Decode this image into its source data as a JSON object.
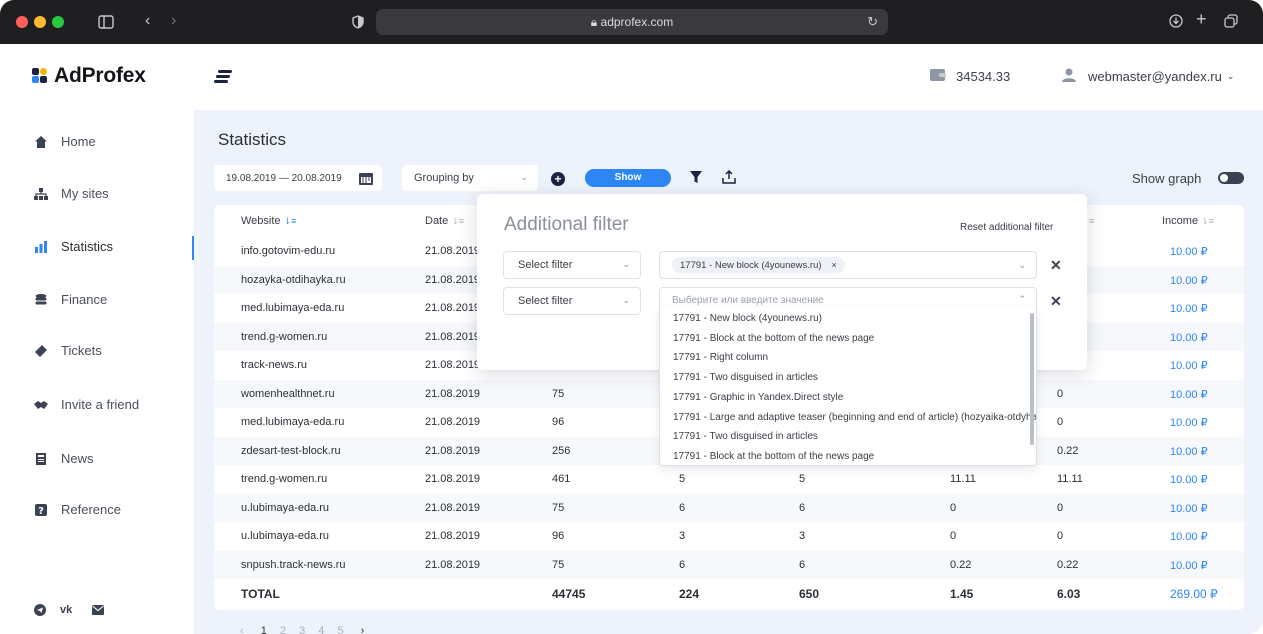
{
  "browser": {
    "url": "adprofex.com"
  },
  "brand": {
    "name": "AdProfex",
    "colors": {
      "accent": "#2e86f5",
      "dark": "#1c2240",
      "logo_yellow": "#f5b400",
      "logo_blue": "#2e86f5",
      "logo_dark": "#1c2240"
    }
  },
  "header": {
    "balance": "34534.33",
    "user_email": "webmaster@yandex.ru"
  },
  "sidebar": {
    "items": [
      {
        "label": "Home",
        "icon": "home-icon"
      },
      {
        "label": "My sites",
        "icon": "sitemap-icon"
      },
      {
        "label": "Statistics",
        "icon": "bar-chart-icon"
      },
      {
        "label": "Finance",
        "icon": "coins-icon"
      },
      {
        "label": "Tickets",
        "icon": "ticket-icon"
      },
      {
        "label": "Invite a friend",
        "icon": "handshake-icon"
      },
      {
        "label": "News",
        "icon": "newspaper-icon"
      },
      {
        "label": "Reference",
        "icon": "question-icon"
      }
    ],
    "active": "Statistics",
    "social": [
      "telegram-icon",
      "vk-icon",
      "mail-icon"
    ]
  },
  "page": {
    "title": "Statistics",
    "date_range": "19.08.2019 — 20.08.2019",
    "grouping_label": "Grouping by",
    "show_label": "Show",
    "show_graph_label": "Show graph"
  },
  "table": {
    "headers": {
      "website": "Website",
      "date": "Date",
      "income": "Income"
    },
    "rows": [
      {
        "website": "info.gotovim-edu.ru",
        "date": "21.08.2019",
        "c1": "",
        "c2": "",
        "c3": "",
        "c4": "",
        "c5": "",
        "income": "10.00 ₽"
      },
      {
        "website": "hozayka-otdihayka.ru",
        "date": "21.08.2019",
        "c1": "",
        "c2": "",
        "c3": "",
        "c4": "",
        "c5": "",
        "income": "10.00 ₽"
      },
      {
        "website": "med.lubimaya-eda.ru",
        "date": "21.08.2019",
        "c1": "",
        "c2": "",
        "c3": "",
        "c4": "",
        "c5": "",
        "income": "10.00 ₽"
      },
      {
        "website": "trend.g-women.ru",
        "date": "21.08.2019",
        "c1": "",
        "c2": "",
        "c3": "",
        "c4": "",
        "c5": "",
        "income": "10.00 ₽"
      },
      {
        "website": "track-news.ru",
        "date": "21.08.2019",
        "c1": "",
        "c2": "",
        "c3": "",
        "c4": "",
        "c5": "",
        "income": "10.00 ₽"
      },
      {
        "website": "womenhealthnet.ru",
        "date": "21.08.2019",
        "c1": "75",
        "c2": "",
        "c3": "",
        "c4": "",
        "c5": "0",
        "income": "10.00 ₽"
      },
      {
        "website": "med.lubimaya-eda.ru",
        "date": "21.08.2019",
        "c1": "96",
        "c2": "",
        "c3": "",
        "c4": "",
        "c5": "0",
        "income": "10.00 ₽"
      },
      {
        "website": "zdesart-test-block.ru",
        "date": "21.08.2019",
        "c1": "256",
        "c2": "",
        "c3": "",
        "c4": "",
        "c5": "0.22",
        "income": "10.00 ₽"
      },
      {
        "website": "trend.g-women.ru",
        "date": "21.08.2019",
        "c1": "461",
        "c2": "5",
        "c3": "5",
        "c4": "11.11",
        "c5": "11.11",
        "income": "10.00 ₽"
      },
      {
        "website": "u.lubimaya-eda.ru",
        "date": "21.08.2019",
        "c1": "75",
        "c2": "6",
        "c3": "6",
        "c4": "0",
        "c5": "0",
        "income": "10.00 ₽"
      },
      {
        "website": "u.lubimaya-eda.ru",
        "date": "21.08.2019",
        "c1": "96",
        "c2": "3",
        "c3": "3",
        "c4": "0",
        "c5": "0",
        "income": "10.00 ₽"
      },
      {
        "website": "snpush.track-news.ru",
        "date": "21.08.2019",
        "c1": "75",
        "c2": "6",
        "c3": "6",
        "c4": "0.22",
        "c5": "0.22",
        "income": "10.00 ₽"
      }
    ],
    "total": {
      "label": "TOTAL",
      "c1": "44745",
      "c2": "224",
      "c3": "650",
      "c4": "1.45",
      "c5": "6.03",
      "income": "269.00 ₽"
    },
    "pagination": [
      "1",
      "2",
      "3",
      "4",
      "5"
    ]
  },
  "filter": {
    "title": "Additional filter",
    "reset_label": "Reset additional filter",
    "select_label": "Select filter",
    "chip": "17791 -  New block (4younews.ru)",
    "chip_close": "×",
    "placeholder": "Выберите или введите значение",
    "options": [
      "17791 - New block (4younews.ru)",
      "17791 - Block at the bottom of the news page",
      "17791 - Right column",
      "17791 - Two disguised in articles",
      "17791 - Graphic in Yandex.Direct style",
      "17791 - Large and adaptive teaser (beginning and end of article)  (hozyaika-otdyhaika.ru)",
      "17791 - Two disguised in articles",
      "17791 - Block at the bottom of the news page"
    ]
  }
}
